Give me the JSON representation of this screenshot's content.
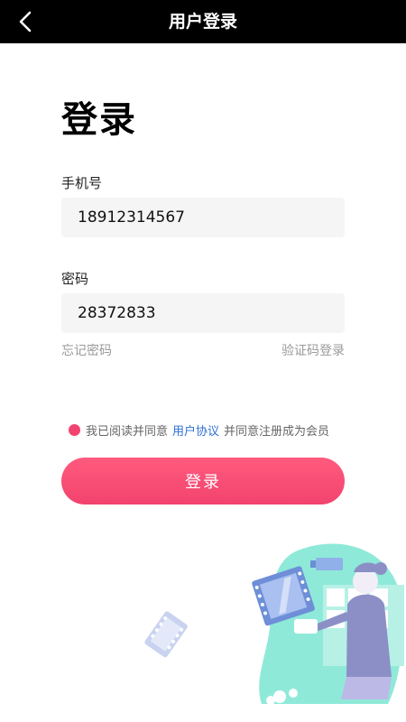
{
  "header": {
    "title": "用户登录",
    "back_icon": "chevron-left-icon"
  },
  "main": {
    "heading": "登录",
    "phone": {
      "label": "手机号",
      "value": "18912314567"
    },
    "password": {
      "label": "密码",
      "value": "28372833"
    },
    "forgot_password": "忘记密码",
    "code_login": "验证码登录",
    "agreement": {
      "prefix": "我已阅读并同意",
      "link": "用户协议",
      "suffix": "并同意注册成为会员"
    },
    "login_button": "登录"
  },
  "colors": {
    "accent": "#f2436e",
    "link": "#2f6fd6",
    "topbar": "#000000",
    "illustration_teal": "#8fe9d9",
    "illustration_purple": "#8c8fc6"
  }
}
